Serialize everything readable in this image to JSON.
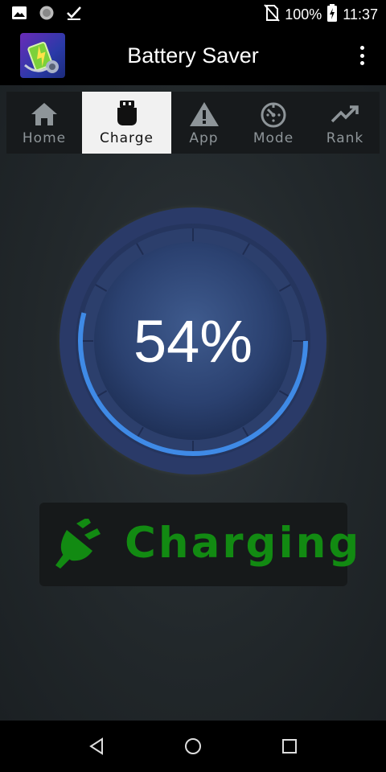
{
  "status_bar": {
    "battery_percent": "100%",
    "time": "11:37"
  },
  "app_bar": {
    "title": "Battery Saver"
  },
  "tabs": [
    {
      "label": "Home",
      "icon": "home-icon",
      "active": false
    },
    {
      "label": "Charge",
      "icon": "charger-icon",
      "active": true
    },
    {
      "label": "App",
      "icon": "warning-icon",
      "active": false
    },
    {
      "label": "Mode",
      "icon": "timer-icon",
      "active": false
    },
    {
      "label": "Rank",
      "icon": "trending-up-icon",
      "active": false
    }
  ],
  "gauge": {
    "value_text": "54%",
    "level": 0.54,
    "progress_color": "#3f8ae6"
  },
  "charging": {
    "label": "Charging",
    "color": "#128a12"
  }
}
